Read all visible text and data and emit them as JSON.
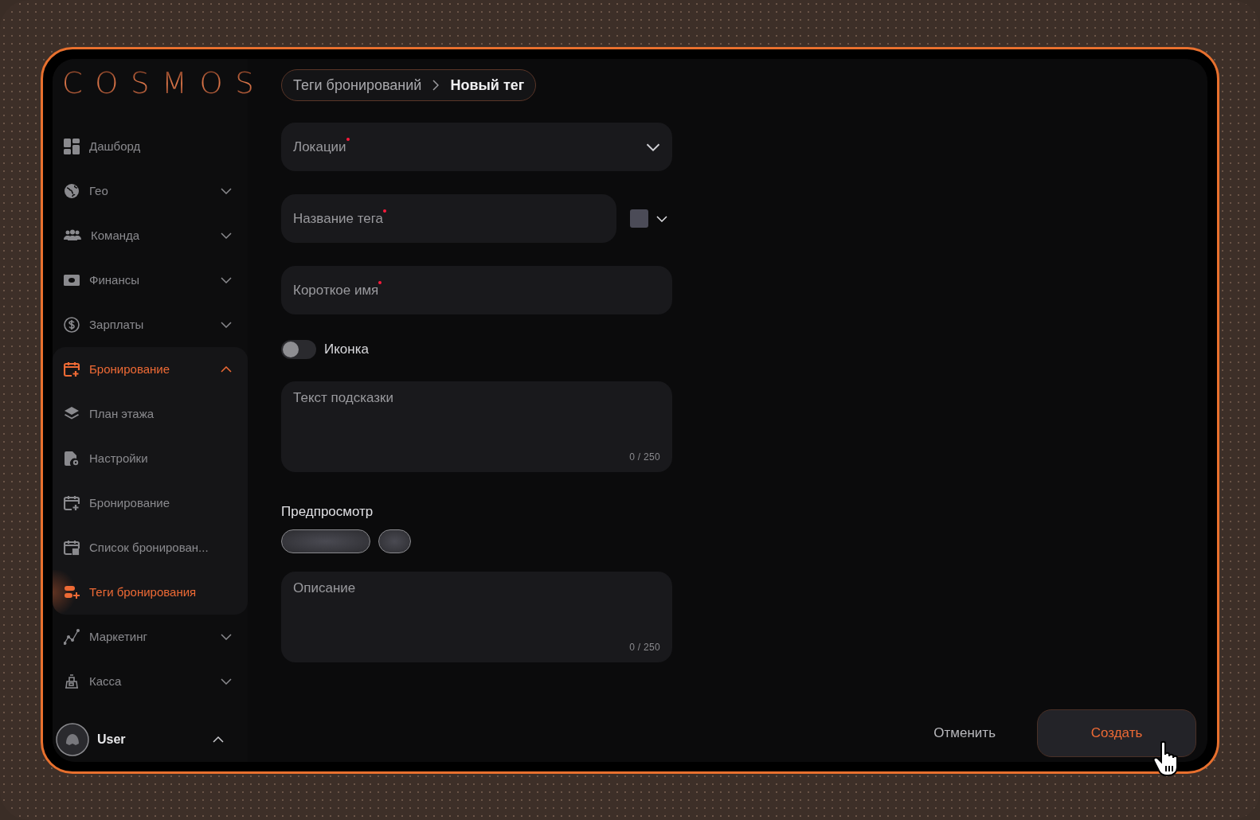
{
  "logo": "COSMOS",
  "sidebar": {
    "items": [
      {
        "label": "Дашборд",
        "selected": false
      },
      {
        "label": "Гео",
        "expanded": false,
        "selected": false
      },
      {
        "label": "Команда",
        "expanded": false,
        "selected": false
      },
      {
        "label": "Финансы",
        "expanded": false,
        "selected": false
      },
      {
        "label": "Зарплаты",
        "expanded": false,
        "selected": false
      },
      {
        "label": "Бронирование",
        "expanded": true,
        "selected": true,
        "children": [
          {
            "label": "План этажа",
            "selected": false
          },
          {
            "label": "Настройки",
            "selected": false
          },
          {
            "label": "Бронирование",
            "selected": false
          },
          {
            "label": "Список бронирован...",
            "selected": false
          },
          {
            "label": "Теги бронирования",
            "selected": true
          }
        ]
      },
      {
        "label": "Маркетинг",
        "expanded": false,
        "selected": false
      },
      {
        "label": "Касса",
        "expanded": false,
        "selected": false
      }
    ]
  },
  "user": {
    "name": "User",
    "expanded": true
  },
  "breadcrumb": [
    {
      "label": "Теги бронирований",
      "current": false
    },
    {
      "label": "Новый тег",
      "current": true
    }
  ],
  "form": {
    "fields": [
      {
        "kind": "select",
        "placeholder": "Локации",
        "required": true
      },
      {
        "kind": "text-color",
        "placeholder": "Название тега",
        "required": true
      },
      {
        "kind": "text",
        "placeholder": "Короткое имя",
        "required": true
      },
      {
        "kind": "toggle",
        "label": "Иконка",
        "on": false
      },
      {
        "kind": "textarea",
        "placeholder": "Текст подсказки",
        "counter": "0 / 250"
      },
      {
        "kind": "preview",
        "label": "Предпросмотр"
      },
      {
        "kind": "textarea",
        "placeholder": "Описание",
        "counter": "0 / 250"
      }
    ]
  },
  "buttons": [
    {
      "kind": "secondary",
      "label": "Отменить"
    },
    {
      "kind": "primary",
      "label": "Создать"
    }
  ]
}
